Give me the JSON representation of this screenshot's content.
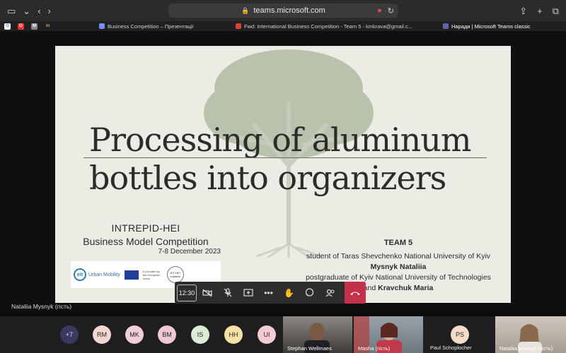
{
  "browser": {
    "url": "teams.microsoft.com",
    "tabs": [
      {
        "title": "Business Competition – Презентації"
      },
      {
        "title": "Fwd: International Business Competition - Team 5 - kmkrava@gmail.c..."
      },
      {
        "title": "Наради | Microsoft Teams classic"
      }
    ]
  },
  "slide": {
    "title_line1": "Processing of aluminum",
    "title_line2": "bottles into organizers",
    "competition": {
      "name": "INTREPID-HEI",
      "event": "Business Model Competition",
      "date": "7-8 December 2023"
    },
    "logos": {
      "supported_by": "Supported by",
      "eit_text": "Urban Mobility",
      "eu_text": "Co-funded by the European Union",
      "hei_text": "EIT HEI Initiative"
    },
    "team": {
      "heading": "TEAM 5",
      "line1": "student of Taras Shevchenko National University of Kyiv",
      "member1": "Mysnyk Nataliia",
      "line2": "postgraduate of Kyiv National University of Technologies",
      "line3_prefix": "and",
      "member2": "Kravchuk Maria"
    }
  },
  "meeting": {
    "timer": "12:30",
    "presenter_caption": "Nataliia Mysnyk (гість)",
    "overflow_count": "+7",
    "participants": [
      {
        "initials": "RM",
        "color": "#f3d6d1"
      },
      {
        "initials": "MK",
        "color": "#f1ccd9"
      },
      {
        "initials": "BM",
        "color": "#f0c7d6"
      },
      {
        "initials": "IS",
        "color": "#dcebd3"
      },
      {
        "initials": "HH",
        "color": "#f6e2a6"
      },
      {
        "initials": "UI",
        "color": "#f4cbd4"
      }
    ],
    "video_tiles": [
      {
        "name": "Stephan Wellmaes"
      },
      {
        "name": "Masha (гість)"
      },
      {
        "name": "Nataliia Mysnyk (гість)"
      }
    ],
    "ps": {
      "initials": "PS",
      "name": "Paul Schoplocher",
      "color": "#f6dcc8"
    }
  }
}
